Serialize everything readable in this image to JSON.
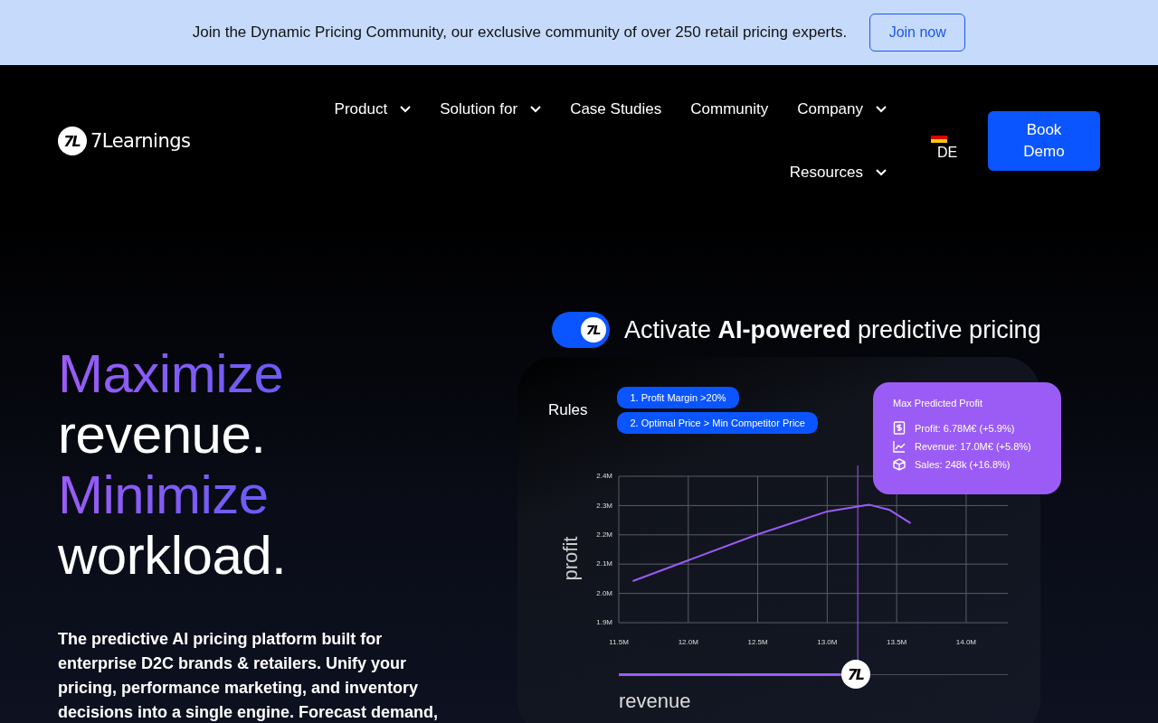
{
  "banner": {
    "text": "Join the Dynamic Pricing Community, our exclusive community of over 250 retail pricing experts.",
    "button": "Join now"
  },
  "nav": {
    "logo": {
      "mark": "7L",
      "name": "7Learnings"
    },
    "links": [
      {
        "label": "Product",
        "dropdown": true
      },
      {
        "label": "Solution for",
        "dropdown": true
      },
      {
        "label": "Case Studies",
        "dropdown": false
      },
      {
        "label": "Community",
        "dropdown": false
      },
      {
        "label": "Company",
        "dropdown": true
      },
      {
        "label": "Resources",
        "dropdown": true
      }
    ],
    "language": "DE",
    "cta": "Book Demo"
  },
  "hero": {
    "headline": [
      {
        "text": "Maximize",
        "accent": true
      },
      {
        "text": "revenue.",
        "accent": false
      },
      {
        "text": "Minimize",
        "accent": true
      },
      {
        "text": "workload.",
        "accent": false
      }
    ],
    "description": "The predictive AI pricing platform built for enterprise D2C brands & retailers. Unify your pricing, performance marketing, and inventory decisions into a single engine. Forecast demand,",
    "visual": {
      "toggle": {
        "on": true,
        "mark": "7L"
      },
      "title": "Activate **AI-powered** predictive pricing",
      "rules_label": "Rules",
      "rules": [
        "1. Profit Margin >20%",
        "2. Optimal Price > Min Competitor Price"
      ],
      "summary": {
        "title": "Max Predicted Profit",
        "items": [
          {
            "kind": "profit",
            "text": "Profit: 6.78M€ (+5.9%)"
          },
          {
            "kind": "revenue",
            "text": "Revenue: 17.0M€ (+5.8%)"
          },
          {
            "kind": "sales",
            "text": "Sales: 248k (+16.8%)"
          }
        ]
      },
      "chart_data": {
        "type": "line",
        "xlabel": "revenue",
        "ylabel": "profit",
        "x": [
          11.6,
          12.0,
          12.5,
          13.0,
          13.3,
          13.45,
          13.6
        ],
        "series": [
          {
            "color": "#9b5cf6",
            "values": [
              2.042,
              2.113,
              2.202,
              2.28,
              2.303,
              2.285,
              2.24
            ]
          }
        ],
        "grid": true,
        "ref_lines": [
          {
            "axis": "x",
            "value": 13.22
          }
        ],
        "xlim": [
          11.5,
          14.3
        ],
        "ylim": [
          1.9,
          2.4
        ],
        "xticks": [
          {
            "value": 11.5,
            "label": "11.5M"
          },
          {
            "value": 12.0,
            "label": "12.0M"
          },
          {
            "value": 12.5,
            "label": "12.5M"
          },
          {
            "value": 13.0,
            "label": "13.0M"
          },
          {
            "value": 13.5,
            "label": "13.5M"
          },
          {
            "value": 14.0,
            "label": "14.0M"
          }
        ],
        "yticks": [
          {
            "value": 1.9,
            "label": "1.9M"
          },
          {
            "value": 2.0,
            "label": "2.0M"
          },
          {
            "value": 2.1,
            "label": "2.1M"
          },
          {
            "value": 2.2,
            "label": "2.2M"
          },
          {
            "value": 2.3,
            "label": "2.3M"
          },
          {
            "value": 2.4,
            "label": "2.4M"
          }
        ]
      },
      "slider": {
        "level": 0.61,
        "mark": "7L"
      }
    }
  }
}
